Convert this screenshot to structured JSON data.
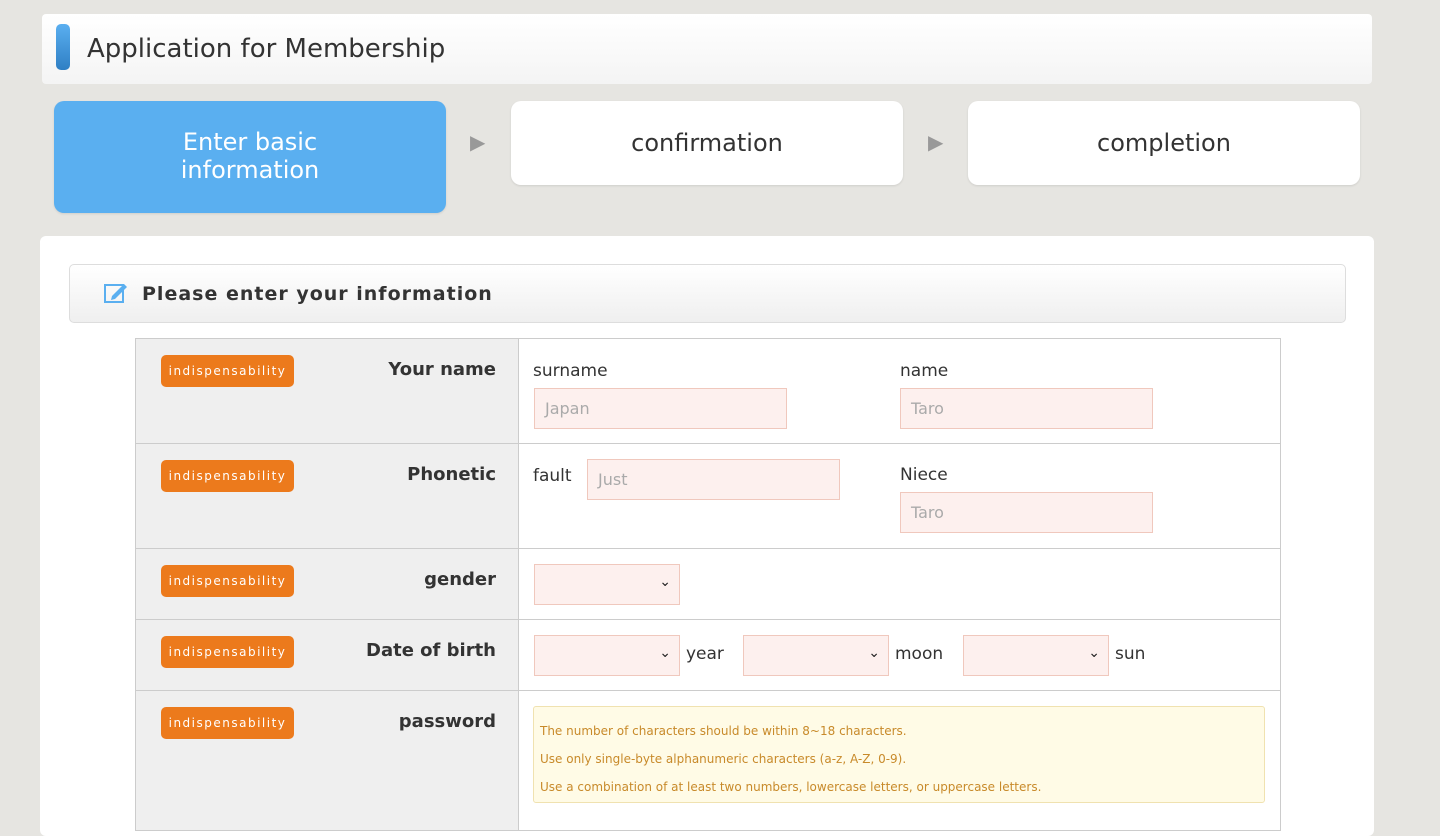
{
  "header": {
    "title": "Application for Membership"
  },
  "steps": [
    {
      "label": "Enter basic information",
      "active": true
    },
    {
      "label": "confirmation",
      "active": false
    },
    {
      "label": "completion",
      "active": false
    }
  ],
  "section": {
    "title": "Please enter your information",
    "icon": "edit-icon"
  },
  "badge": "indispensability",
  "colors": {
    "accent": "#5aaff0",
    "badge": "#ec7a1c",
    "input_bg": "#fdf0ee"
  },
  "rows": {
    "name": {
      "label": "Your name",
      "surname_label": "surname",
      "surname_placeholder": "Japan",
      "name_label": "name",
      "name_placeholder": "Taro"
    },
    "phonetic": {
      "label": "Phonetic",
      "fault_label": "fault",
      "fault_placeholder": "Just",
      "niece_label": "Niece",
      "niece_placeholder": "Taro"
    },
    "gender": {
      "label": "gender"
    },
    "dob": {
      "label": "Date of birth",
      "year": "year",
      "month": "moon",
      "day": "sun"
    },
    "password": {
      "label": "password",
      "notes": [
        "The number of characters should be within 8~18 characters.",
        "Use only single-byte alphanumeric characters (a-z, A-Z, 0-9).",
        "Use a combination of at least two numbers, lowercase letters, or uppercase letters."
      ]
    }
  }
}
